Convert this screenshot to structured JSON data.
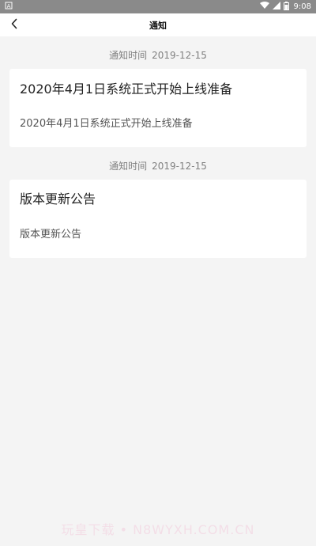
{
  "status_bar": {
    "time": "9:08",
    "left_icon": "a-icon",
    "icons": [
      "wifi-icon",
      "signal-icon",
      "battery-icon"
    ]
  },
  "header": {
    "title": "通知",
    "back_icon": "chevron-left-icon"
  },
  "notifications": [
    {
      "time_prefix": "通知时间",
      "date": "2019-12-15",
      "title": "2020年4月1日系统正式开始上线准备",
      "body": "2020年4月1日系统正式开始上线准备"
    },
    {
      "time_prefix": "通知时间",
      "date": "2019-12-15",
      "title": "版本更新公告",
      "body": "版本更新公告"
    }
  ],
  "watermark": "玩皇下载 • N8WYXH.COM.CN",
  "colors": {
    "status_bar": "#8a8a8a",
    "background": "#f4f4f4",
    "card": "#ffffff",
    "time_text": "#808080"
  }
}
